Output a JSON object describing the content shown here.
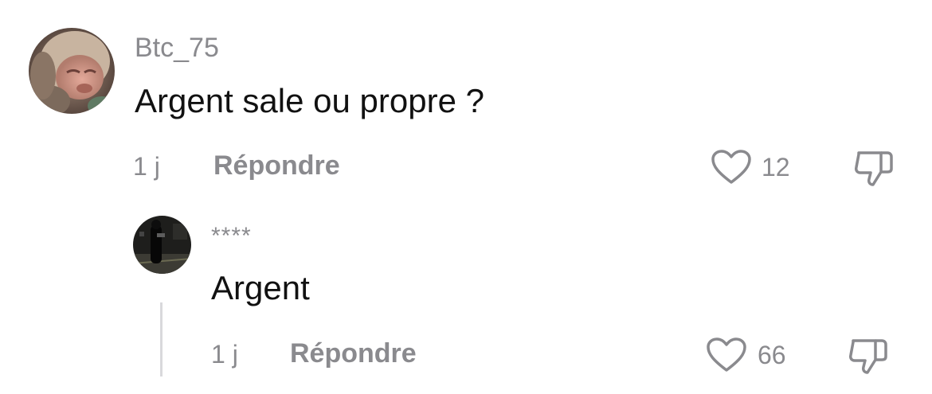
{
  "comment": {
    "username": "Btc_75",
    "text": "Argent sale ou propre ?",
    "timestamp": "1 j",
    "reply_label": "Répondre",
    "likes": "12"
  },
  "reply": {
    "username": "****",
    "text": "Argent",
    "timestamp": "1 j",
    "reply_label": "Répondre",
    "likes": "66"
  },
  "icons": {
    "like": "heart-outline-icon",
    "dislike": "thumbs-down-outline-icon"
  },
  "colors": {
    "text_primary": "#111111",
    "text_secondary": "#8a8a8e",
    "thread_line": "#d9d9dc"
  }
}
